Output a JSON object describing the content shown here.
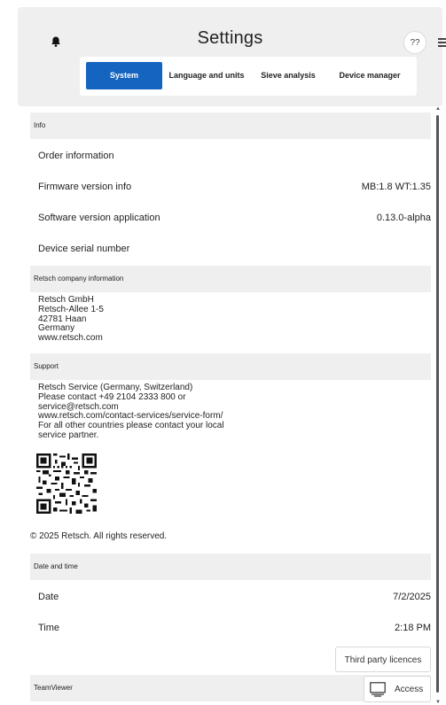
{
  "header": {
    "title": "Settings",
    "help_label": "??"
  },
  "tabs": [
    {
      "label": "System",
      "active": true
    },
    {
      "label": "Language and units",
      "active": false
    },
    {
      "label": "Sieve analysis",
      "active": false
    },
    {
      "label": "Device manager",
      "active": false
    }
  ],
  "info": {
    "header": "Info",
    "rows": [
      {
        "label": "Order information",
        "value": ""
      },
      {
        "label": "Firmware version info",
        "value": "MB:1.8 WT:1.35"
      },
      {
        "label": "Software version application",
        "value": "0.13.0-alpha"
      },
      {
        "label": "Device serial number",
        "value": ""
      }
    ]
  },
  "company": {
    "header": "Retsch company information",
    "lines": [
      "Retsch GmbH",
      "Retsch-Allee 1-5",
      "42781 Haan",
      "Germany",
      "www.retsch.com"
    ]
  },
  "support": {
    "header": "Support",
    "lines": [
      "Retsch Service (Germany, Switzerland)",
      "Please contact +49 2104 2333 800 or",
      "service@retsch.com",
      "www.retsch.com/contact-services/service-form/",
      "For all other countries please contact your local",
      "service partner."
    ]
  },
  "copyright": "© 2025 Retsch. All rights reserved.",
  "datetime": {
    "header": "Date and time",
    "rows": [
      {
        "label": "Date",
        "value": "7/2/2025"
      },
      {
        "label": "Time",
        "value": "2:18 PM"
      }
    ]
  },
  "third_party_label": "Third party licences",
  "teamviewer": {
    "header": "TeamViewer",
    "access_label": "Access"
  },
  "colors": {
    "accent": "#1565c0",
    "section_bg": "#efefef",
    "header_bg": "#efefef"
  }
}
